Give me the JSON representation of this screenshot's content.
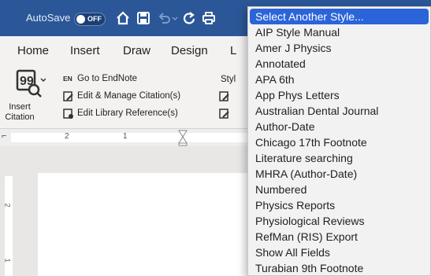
{
  "titlebar": {
    "autosave_label": "AutoSave",
    "toggle_text": "OFF",
    "icons": [
      "home-icon",
      "save-icon",
      "undo-icon",
      "redo-icon",
      "print-icon"
    ],
    "bg_color": "#2b5798"
  },
  "ribbon": {
    "tabs": [
      "Home",
      "Insert",
      "Draw",
      "Design",
      "L"
    ],
    "insert_citation_line1": "Insert",
    "insert_citation_line2": "Citation",
    "en_badge": "EN",
    "commands": [
      "Go to EndNote",
      "Edit & Manage Citation(s)",
      "Edit Library Reference(s)"
    ],
    "style_label": "Styl"
  },
  "ruler": {
    "numbers": [
      "2",
      "1"
    ]
  },
  "vruler": {
    "numbers": [
      "2",
      "1"
    ]
  },
  "style_menu": {
    "selected_index": 0,
    "selected_color": "#2b64d9",
    "items": [
      "Select Another Style...",
      "AIP Style Manual",
      "Amer J Physics",
      "Annotated",
      "APA 6th",
      "App Phys Letters",
      "Australian Dental Journal",
      "Author-Date",
      "Chicago 17th Footnote",
      "Literature searching",
      "MHRA (Author-Date)",
      "Numbered",
      "Physics Reports",
      "Physiological Reviews",
      "RefMan (RIS) Export",
      "Show All Fields",
      "Turabian 9th Footnote"
    ]
  }
}
